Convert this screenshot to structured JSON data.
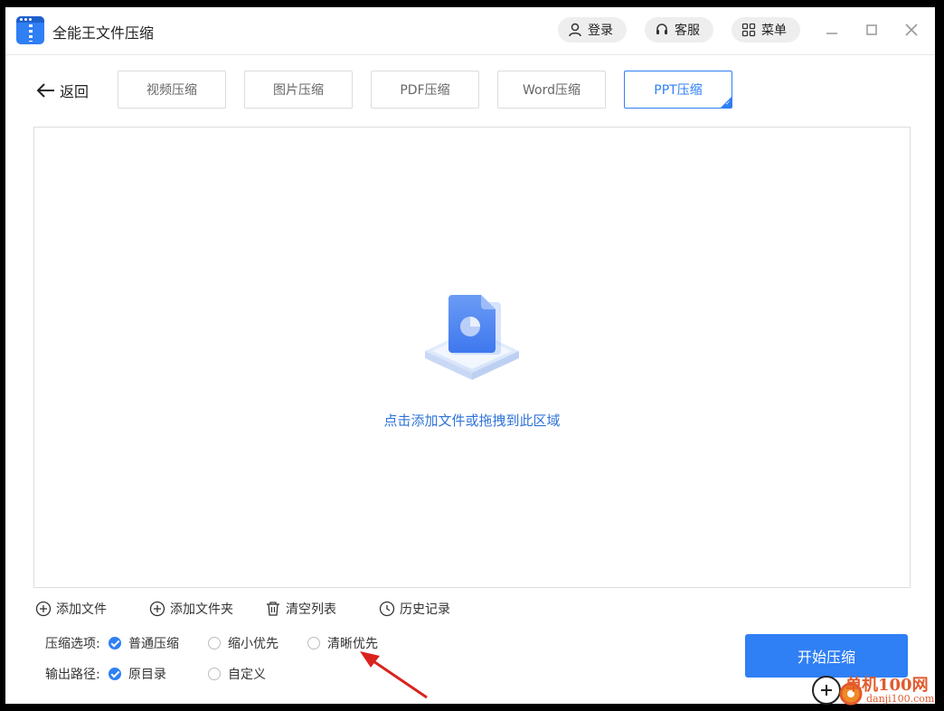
{
  "app": {
    "title": "全能王文件压缩"
  },
  "header": {
    "login": "登录",
    "service": "客服",
    "menu": "菜单"
  },
  "nav": {
    "back": "返回",
    "tabs": [
      {
        "label": "视频压缩"
      },
      {
        "label": "图片压缩"
      },
      {
        "label": "PDF压缩"
      },
      {
        "label": "Word压缩"
      },
      {
        "label": "PPT压缩"
      }
    ],
    "active_tab": "PPT压缩"
  },
  "drop_area": {
    "hint": "点击添加文件或拖拽到此区域"
  },
  "actions": {
    "add_file": "添加文件",
    "add_folder": "添加文件夹",
    "clear_list": "清空列表",
    "history": "历史记录"
  },
  "options": {
    "compress_label": "压缩选项:",
    "compress_choices": [
      {
        "label": "普通压缩",
        "selected": true
      },
      {
        "label": "缩小优先",
        "selected": false
      },
      {
        "label": "清晰优先",
        "selected": false
      }
    ],
    "output_label": "输出路径:",
    "output_choices": [
      {
        "label": "原目录",
        "selected": true
      },
      {
        "label": "自定义",
        "selected": false
      }
    ]
  },
  "start_button": "开始压缩",
  "watermark": {
    "title": "单机100网",
    "url": "danji100.com"
  },
  "colors": {
    "accent": "#2f7ff5",
    "hint_text": "#2f73d9",
    "annotation_arrow": "#d9231f"
  }
}
